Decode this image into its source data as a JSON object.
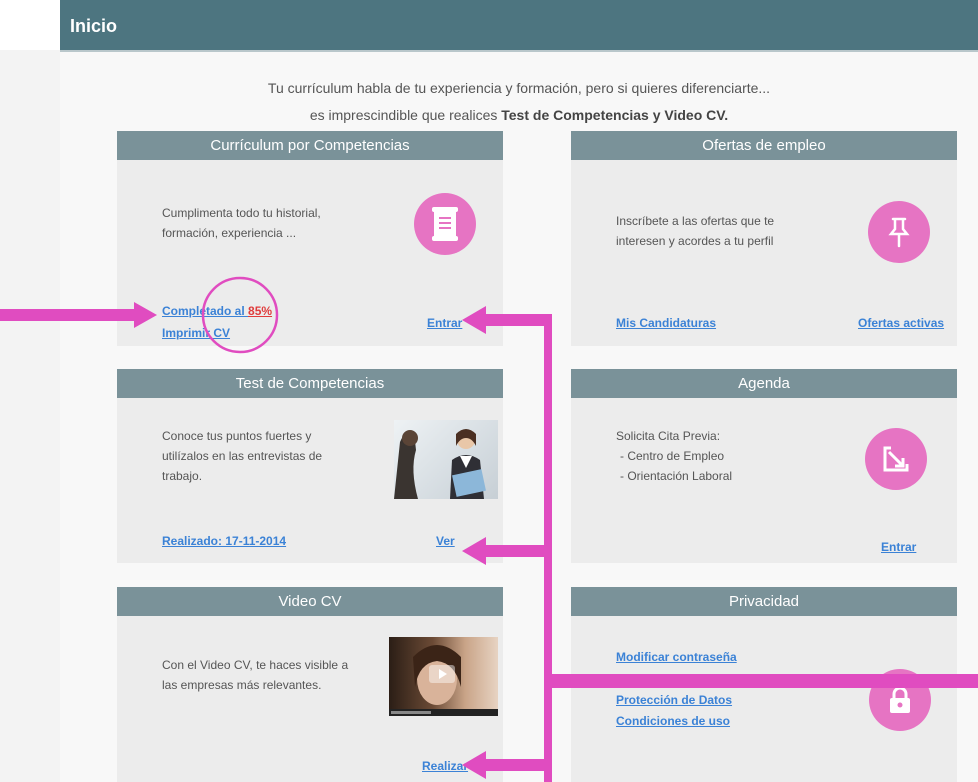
{
  "header": {
    "title": "Inicio"
  },
  "intro": {
    "line1": "Tu currículum habla de tu experiencia y formación, pero si quieres diferenciarte...",
    "line2_prefix": "es imprescindible que realices ",
    "line2_bold": "Test de Competencias y Video CV."
  },
  "cards": {
    "curriculum": {
      "title": "Currículum por Competencias",
      "text1": "Cumplimenta todo tu historial,",
      "text2": "formación, experiencia ...",
      "completed_label": "Completado al ",
      "completed_pct": "85%",
      "print_label": "Imprimir CV",
      "enter_label": "Entrar",
      "icon": "document-icon"
    },
    "ofertas": {
      "title": "Ofertas de empleo",
      "text1": "Inscríbete a las ofertas que te",
      "text2": "interesen y acordes a tu perfil",
      "link_left": "Mis Candidaturas",
      "link_right": "Ofertas activas",
      "icon": "pushpin-icon"
    },
    "test": {
      "title": "Test de Competencias",
      "text1": "Conoce tus puntos fuertes y",
      "text2": "utilízalos en las entrevistas de",
      "text3": "trabajo.",
      "done_label": "Realizado: 17-11-2014",
      "view_label": "Ver"
    },
    "agenda": {
      "title": "Agenda",
      "text1": "Solicita Cita Previa:",
      "text2": "- Centro de Empleo",
      "text3": "- Orientación Laboral",
      "enter_label": "Entrar",
      "icon": "edit-icon"
    },
    "video": {
      "title": "Video CV",
      "text1": "Con el Video CV, te haces visible a",
      "text2": "las empresas más relevantes.",
      "do_label": "Realizar"
    },
    "privacidad": {
      "title": "Privacidad",
      "link1": "Modificar contraseña",
      "link2": "Protección de Datos",
      "link3": "Condiciones de uso",
      "icon": "lock-icon"
    }
  },
  "colors": {
    "header_bg": "#4d7580",
    "card_header_bg": "#7a9299",
    "accent_pink": "#e674c3",
    "annotation_magenta": "#e04cc0",
    "link_blue": "#3b82d6",
    "percent_red": "#e03c3c"
  }
}
